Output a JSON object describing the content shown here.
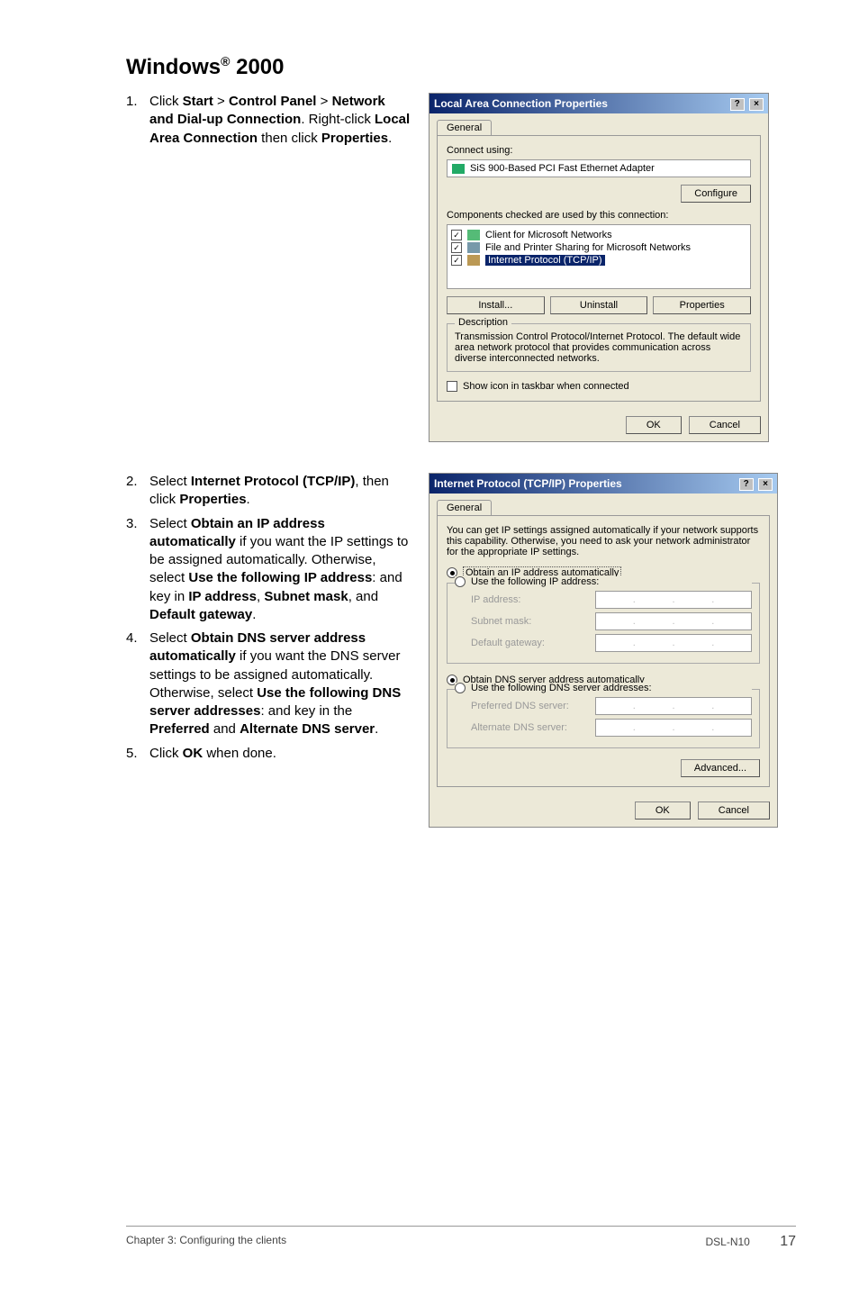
{
  "heading": {
    "pre": "Windows",
    "sup": "®",
    "post": " 2000"
  },
  "step1": {
    "num": "1.",
    "t1": "Click ",
    "b1": "Start",
    "t2": " > ",
    "b2": "Control Panel",
    "t3": " > ",
    "b3": "Network and Dial-up Connection",
    "t4": ". Right-click ",
    "b4": "Local Area Connection",
    "t5": " then click ",
    "b5": "Properties",
    "t6": "."
  },
  "dlg1": {
    "title": "Local Area Connection Properties",
    "tab": "General",
    "connect_using": "Connect using:",
    "adapter": "SiS 900-Based PCI Fast Ethernet Adapter",
    "configure": "Configure",
    "components_label": "Components checked are used by this connection:",
    "item1": "Client for Microsoft Networks",
    "item2": "File and Printer Sharing for Microsoft Networks",
    "item3": "Internet Protocol (TCP/IP)",
    "install": "Install...",
    "uninstall": "Uninstall",
    "properties": "Properties",
    "desc_title": "Description",
    "desc_text": "Transmission Control Protocol/Internet Protocol. The default wide area network protocol that provides communication across diverse interconnected networks.",
    "show_icon": "Show icon in taskbar when connected",
    "ok": "OK",
    "cancel": "Cancel"
  },
  "step2": {
    "num": "2.",
    "t1": "Select ",
    "b1": "Internet Protocol (TCP/IP)",
    "t2": ", then click ",
    "b2": "Properties",
    "t3": "."
  },
  "step3": {
    "num": "3.",
    "t1": "Select ",
    "b1": "Obtain an IP address automatically",
    "t2": " if you want the IP settings to be assigned automatically. Otherwise, select ",
    "b2": "Use the following IP address",
    "t3": ": and key in ",
    "b3": "IP address",
    "t4": ", ",
    "b4": "Subnet mask",
    "t5": ", and ",
    "b5": "Default gateway",
    "t6": "."
  },
  "step4": {
    "num": "4.",
    "t1": "Select ",
    "b1": "Obtain DNS server address automatically",
    "t2": " if you want the DNS server settings to be assigned automatically. Otherwise, select ",
    "b2": "Use the following DNS server addresses",
    "t3": ": and key in the ",
    "b3": "Preferred",
    "t4": " and ",
    "b4": "Alternate DNS server",
    "t5": "."
  },
  "step5": {
    "num": "5.",
    "t1": "Click ",
    "b1": "OK",
    "t2": " when done."
  },
  "dlg2": {
    "title": "Internet Protocol (TCP/IP) Properties",
    "tab": "General",
    "intro": "You can get IP settings assigned automatically if your network supports this capability. Otherwise, you need to ask your network administrator for the appropriate IP settings.",
    "r1": "Obtain an IP address automatically",
    "r2": "Use the following IP address:",
    "ip": "IP address:",
    "mask": "Subnet mask:",
    "gw": "Default gateway:",
    "r3": "Obtain DNS server address automatically",
    "r4": "Use the following DNS server addresses:",
    "pdns": "Preferred DNS server:",
    "adns": "Alternate DNS server:",
    "adv": "Advanced...",
    "ok": "OK",
    "cancel": "Cancel"
  },
  "footer": {
    "left": "Chapter 3: Configuring the clients",
    "right_model": "DSL-N10",
    "right_page": "17"
  }
}
